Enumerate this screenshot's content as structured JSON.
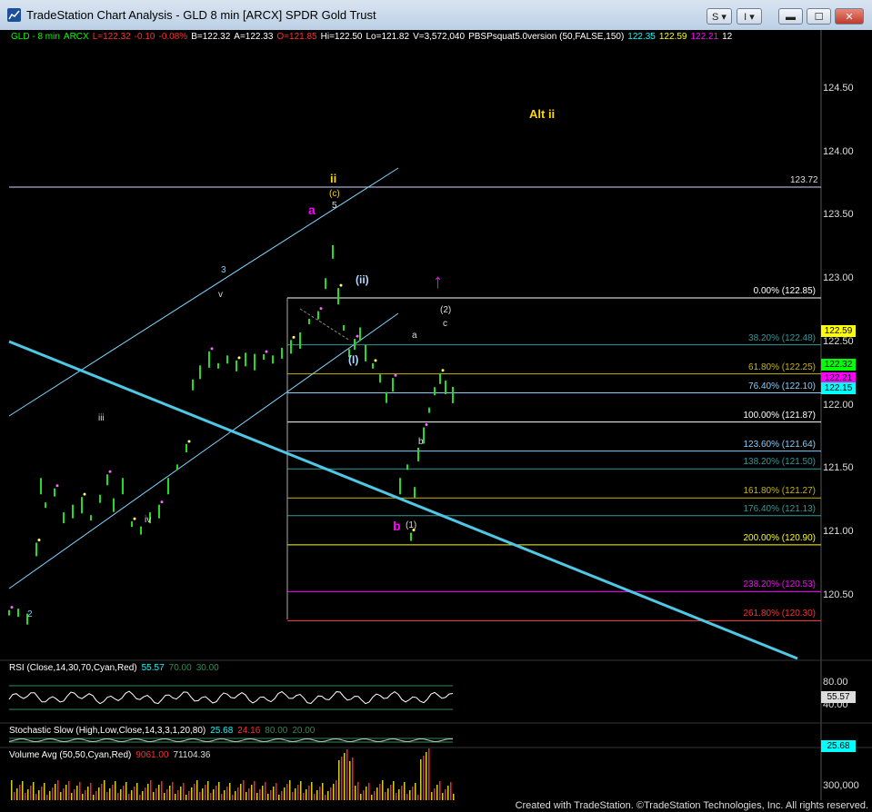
{
  "window": {
    "title": "TradeStation Chart Analysis - GLD 8 min [ARCX] SPDR Gold Trust",
    "style_button": "S",
    "indicator_button": "I",
    "minimize": "▬",
    "maximize": "☐",
    "close": "✕"
  },
  "header": {
    "symbol": "GLD - 8 min",
    "exchange": "ARCX",
    "last": "L=122.32",
    "change": "-0.10",
    "change_pct": "-0.08%",
    "bid": "B=122.32",
    "ask": "A=122.33",
    "open": "O=121.85",
    "high": "Hi=122.50",
    "low": "Lo=121.82",
    "volume": "V=3,572,040",
    "indicator": "PBSPsquat5.0version (50,FALSE,150)",
    "ind_v1": "122.35",
    "ind_v2": "122.59",
    "ind_v3": "122.21",
    "ind_v4": "12"
  },
  "price_axis": {
    "ticks": [
      "124.50",
      "124.00",
      "123.50",
      "123.00",
      "122.50",
      "122.00",
      "121.50",
      "121.00",
      "120.50"
    ],
    "boxes": [
      {
        "text": "122.59",
        "color": "#ffff00"
      },
      {
        "text": "122.32",
        "color": "#00ff00"
      },
      {
        "text": "122.21",
        "color": "#ff00ff"
      },
      {
        "text": "122.15",
        "color": "#00ffff"
      }
    ]
  },
  "levels": {
    "line_price": "123.72",
    "fibs": [
      {
        "text": "0.00% (122.85)",
        "color": "#ffffff"
      },
      {
        "text": "38.20% (122.48)",
        "color": "#2f9a9a"
      },
      {
        "text": "61.80% (122.25)",
        "color": "#c8b400"
      },
      {
        "text": "76.40% (122.10)",
        "color": "#87cefa"
      },
      {
        "text": "100.00% (121.87)",
        "color": "#ffffff"
      },
      {
        "text": "123.60% (121.64)",
        "color": "#87cefa"
      },
      {
        "text": "138.20% (121.50)",
        "color": "#2f9a9a"
      },
      {
        "text": "161.80% (121.27)",
        "color": "#c8b400"
      },
      {
        "text": "176.40% (121.13)",
        "color": "#2f9a9a"
      },
      {
        "text": "200.00% (120.90)",
        "color": "#ffff00"
      },
      {
        "text": "238.20% (120.53)",
        "color": "#ff00ff"
      },
      {
        "text": "261.80% (120.30)",
        "color": "#ff3030"
      }
    ]
  },
  "annotations": {
    "alt": "Alt ii",
    "ii": "ii",
    "c_paren": "(c)",
    "five": "5",
    "a_magenta": "a",
    "three": "3",
    "v": "v",
    "iii": "iii",
    "iv": "iv",
    "two": "2",
    "ii_paren": "(ii)",
    "i_paren": "(I)",
    "a_small": "a",
    "b_small": "b",
    "c_small": "c",
    "two_paren": "(2)",
    "one_paren": "(1)",
    "b_magenta": "b",
    "arrow": "↑"
  },
  "rsi": {
    "label": "RSI (Close,14,30,70,Cyan,Red)",
    "value": "55.57",
    "ob": "70.00",
    "os": "30.00",
    "tick_top": "80.00",
    "tick_bottom": "40.00",
    "box": "55.57"
  },
  "stoch": {
    "label": "Stochastic Slow (High,Low,Close,14,3,3,1,20,80)",
    "k": "25.68",
    "d": "24.16",
    "ob": "80.00",
    "os": "20.00",
    "box": "25.68"
  },
  "volume": {
    "label": "Volume Avg (50,50,Cyan,Red)",
    "vol": "9061.00",
    "avg": "71104.36",
    "tick": "300,000"
  },
  "footer": "Created with TradeStation. ©TradeStation Technologies, Inc. All rights reserved."
}
